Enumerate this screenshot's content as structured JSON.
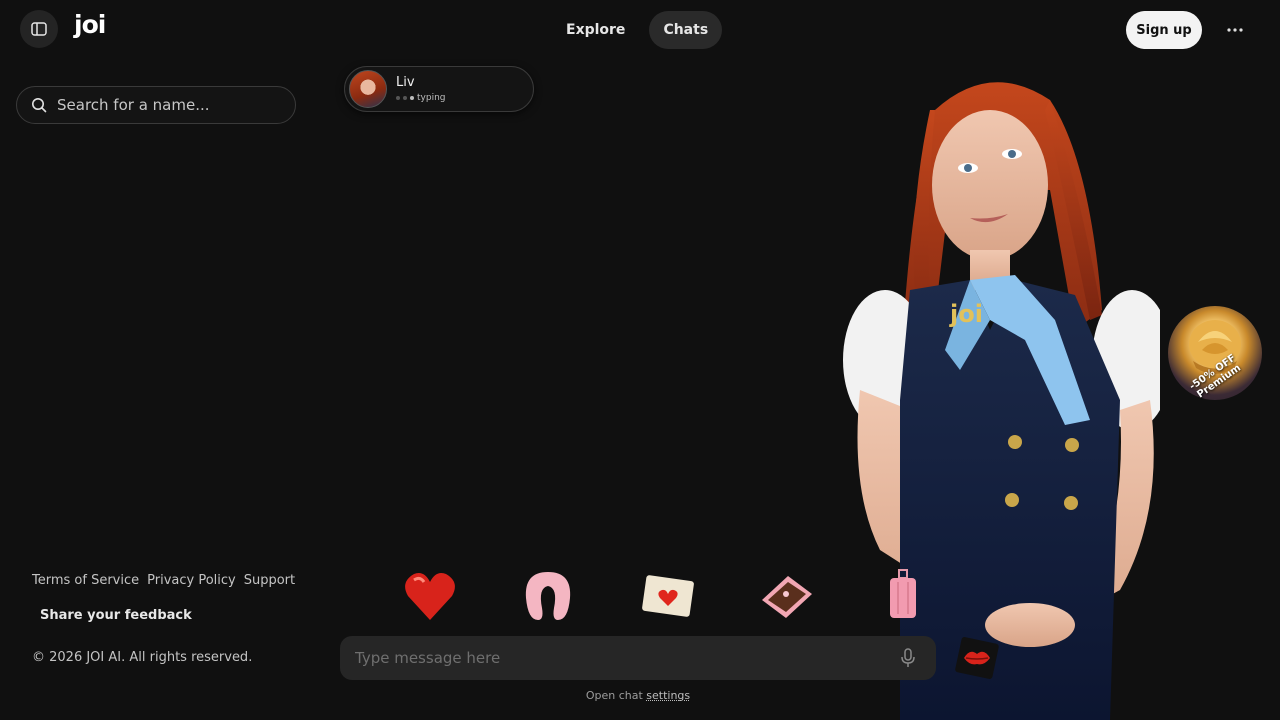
{
  "app": {
    "logo_text": "joi"
  },
  "header": {
    "tabs": [
      {
        "label": "Explore",
        "active": false
      },
      {
        "label": "Chats",
        "active": true
      }
    ],
    "signup_label": "Sign up",
    "more_label": "···"
  },
  "sidebar": {
    "search_placeholder": "Search for a name...",
    "footer_links": [
      "Terms of Service",
      "Privacy Policy",
      "Support"
    ],
    "feedback_label": "Share your feedback",
    "copyright": "© 2026 JOI AI. All rights reserved."
  },
  "chat": {
    "character_name": "Liv",
    "status": "typing",
    "badge_text": "joi",
    "promo_text": "-50% OFF Premium",
    "gifts": [
      "heart-gift",
      "neck-pillow-gift",
      "love-letter-gift",
      "chocolate-box-gift",
      "suitcase-gift"
    ],
    "composer_placeholder": "Type message here",
    "settings_prefix": "Open chat ",
    "settings_link": "settings"
  },
  "colors": {
    "background": "#101010",
    "panel": "#262626",
    "accent_light": "#f3f3f3"
  }
}
